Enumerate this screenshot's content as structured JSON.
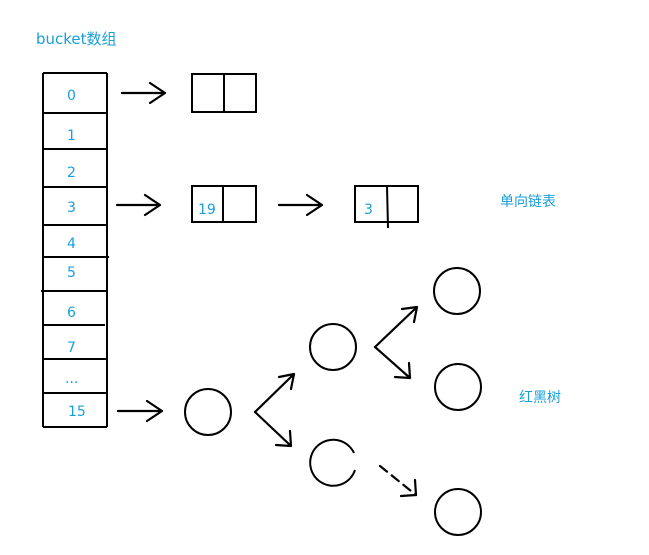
{
  "title": "bucket数组",
  "colors": {
    "ink": "#000000",
    "label": "#1a9fd8"
  },
  "buckets": [
    "0",
    "1",
    "2",
    "3",
    "4",
    "5",
    "6",
    "7",
    "...",
    "15"
  ],
  "linked_list": {
    "label": "单向链表",
    "nodes": [
      {
        "value": ""
      },
      {
        "value": "19"
      },
      {
        "value": "3"
      }
    ]
  },
  "tree": {
    "label": "红黑树"
  }
}
